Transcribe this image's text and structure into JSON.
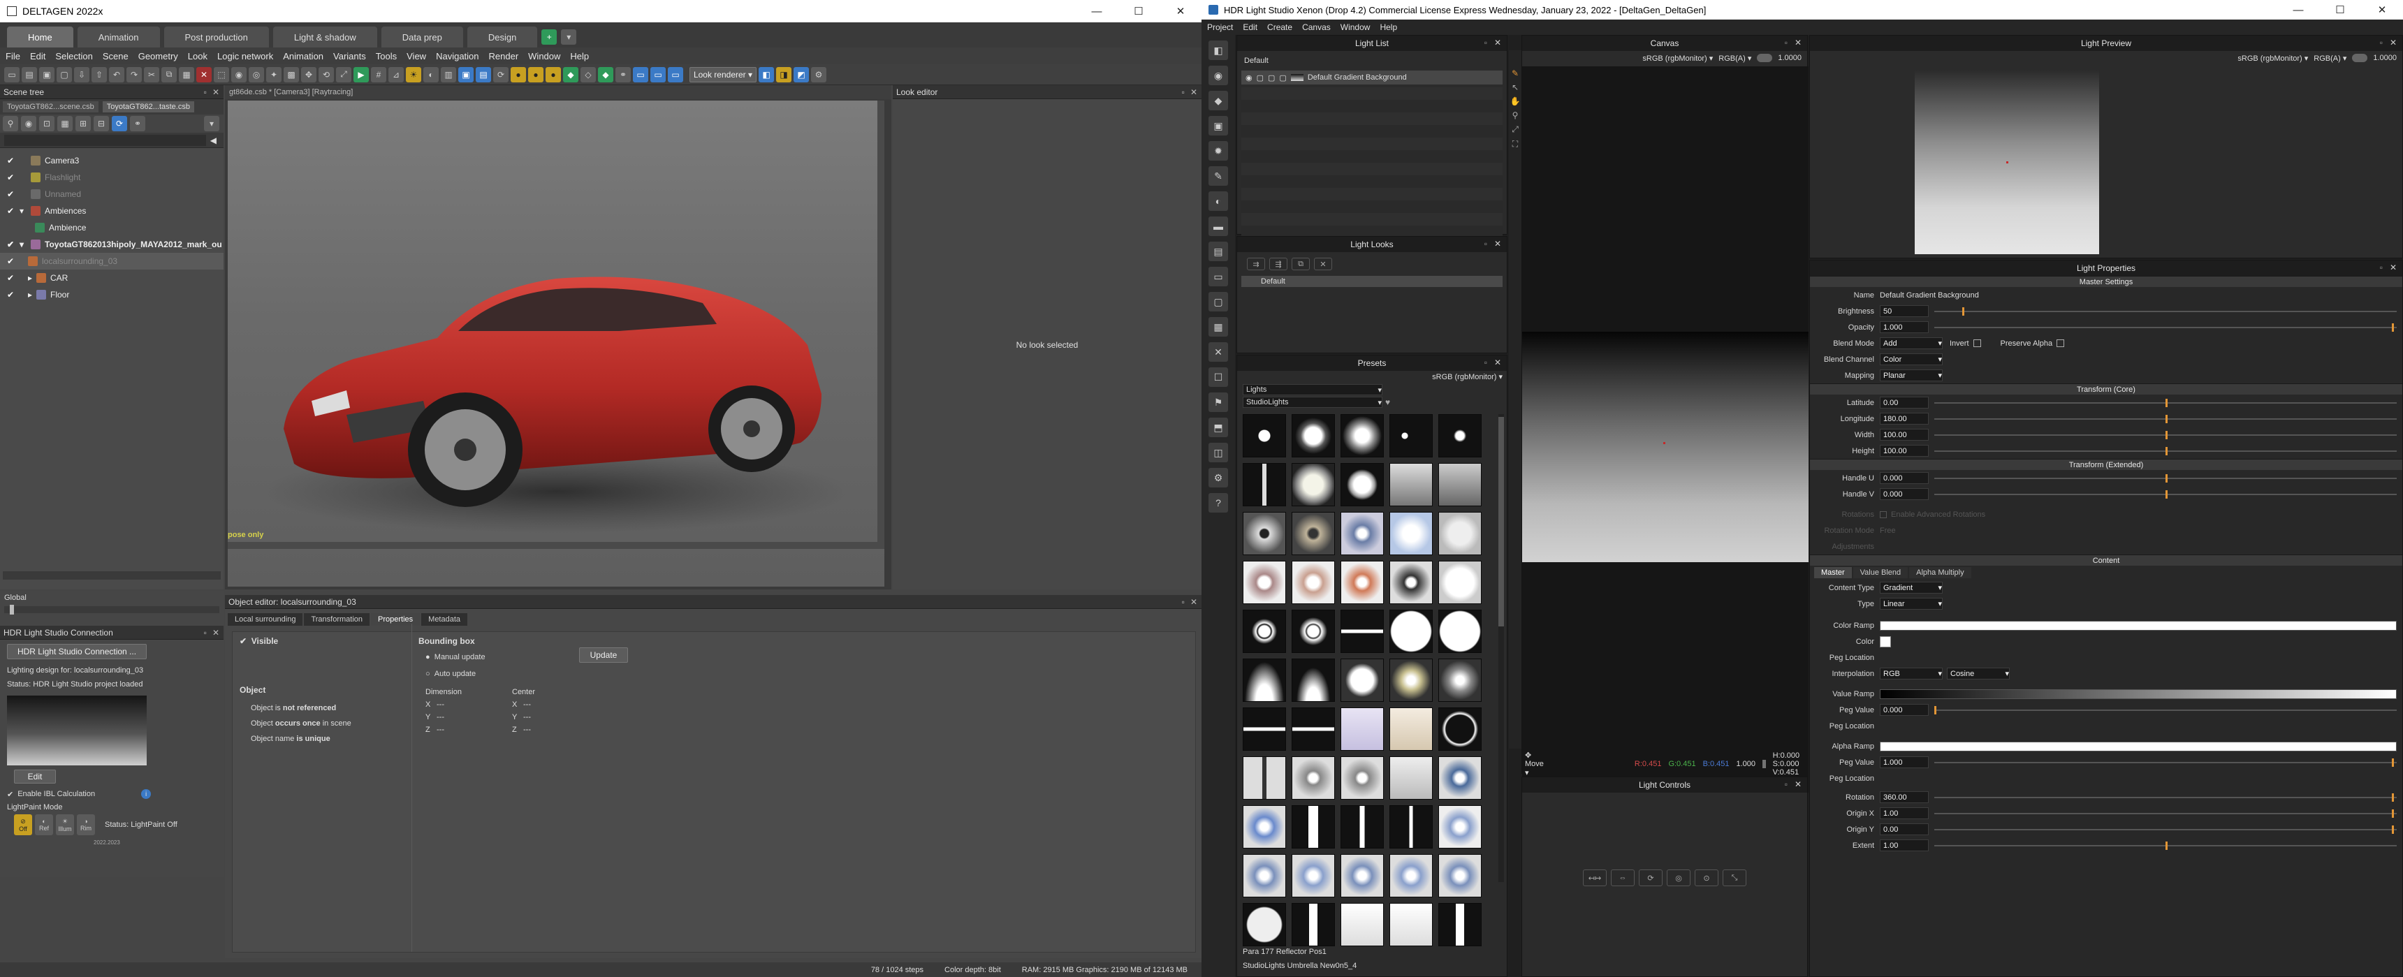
{
  "left_app": {
    "title": "DELTAGEN  2022x",
    "mode_tabs": [
      "Home",
      "Animation",
      "Post production",
      "Light & shadow",
      "Data prep",
      "Design"
    ],
    "menu": [
      "File",
      "Edit",
      "Selection",
      "Scene",
      "Geometry",
      "Look",
      "Logic network",
      "Animation",
      "Variants",
      "Tools",
      "View",
      "Navigation",
      "Render",
      "Window",
      "Help"
    ],
    "look_renderer": "Look renderer",
    "scene_tree": {
      "title": "Scene tree",
      "file_tabs": [
        "ToyotaGT862...scene.csb",
        "ToyotaGT862...taste.csb"
      ],
      "items": [
        {
          "label": "Camera3",
          "checked": true,
          "dim": false,
          "indent": 0
        },
        {
          "label": "Flashlight",
          "checked": true,
          "dim": true,
          "indent": 0
        },
        {
          "label": "Unnamed",
          "checked": true,
          "dim": true,
          "indent": 0
        },
        {
          "label": "Ambiences",
          "checked": true,
          "dim": false,
          "indent": 0
        },
        {
          "label": "Ambience",
          "checked": false,
          "dim": false,
          "indent": 1
        },
        {
          "label": "ToyotaGT862013hipoly_MAYA2012_mark_ou",
          "checked": true,
          "dim": false,
          "bold": true,
          "indent": 0
        },
        {
          "label": "localsurrounding_03",
          "checked": true,
          "dim": true,
          "indent": 1
        },
        {
          "label": "CAR",
          "checked": true,
          "dim": false,
          "indent": 1
        },
        {
          "label": "Floor",
          "checked": true,
          "dim": false,
          "indent": 1
        }
      ]
    },
    "viewport": {
      "tab_label": "gt86de.csb * [Camera3] [Raytracing]",
      "status_text": "pose only"
    },
    "look_editor": {
      "title": "Look editor",
      "empty_text": "No look selected"
    },
    "global_label": "Global",
    "hdr_connection": {
      "title": "HDR Light Studio Connection",
      "connect_button": "HDR Light Studio Connection ...",
      "lighting_design": "Lighting design for: localsurrounding_03",
      "status": "Status: HDR Light Studio project loaded",
      "edit_button": "Edit",
      "enable_ibl": "Enable IBL Calculation",
      "lightpaint_mode": "LightPaint Mode",
      "lightpaint_status": "Status: LightPaint Off",
      "lightpaint_buttons": [
        "Off",
        "Ref",
        "Illum",
        "Rim"
      ],
      "version": "2022.2023"
    },
    "object_editor": {
      "title": "Object editor: localsurrounding_03",
      "tabs": [
        "Local surrounding",
        "Transformation",
        "Properties",
        "Metadata"
      ],
      "active_tab": "Properties",
      "visible_label": "Visible",
      "object_header": "Object",
      "object_lines": [
        {
          "prefix": "Object is ",
          "bold": "not referenced",
          "suffix": ""
        },
        {
          "prefix": "Object ",
          "bold": "occurs once",
          "suffix": " in scene"
        },
        {
          "prefix": "Object name ",
          "bold": "is unique",
          "suffix": ""
        }
      ],
      "bbox_header": "Bounding box",
      "manual_update": "Manual update",
      "auto_update": "Auto update",
      "update_button": "Update",
      "dimension_label": "Dimension",
      "center_label": "Center",
      "axes": [
        "X",
        "Y",
        "Z"
      ],
      "dash": "---"
    },
    "statusbar": {
      "steps": "78 / 1024 steps",
      "color_depth": "Color depth: 8bit",
      "memory": "RAM: 2915 MB  Graphics: 2190 MB of 12143 MB"
    }
  },
  "right_app": {
    "title": "HDR Light Studio Xenon (Drop 4.2) Commercial License Express Wednesday, January 23, 2022 - [DeltaGen_DeltaGen]",
    "menu": [
      "Project",
      "Edit",
      "Create",
      "Canvas",
      "Window",
      "Help"
    ],
    "light_list": {
      "title": "Light List",
      "group": "Default",
      "item": "Default Gradient Background"
    },
    "light_looks": {
      "title": "Light Looks",
      "item": "Default"
    },
    "presets": {
      "title": "Presets",
      "colorspace": "sRGB (rgbMonitor)",
      "category": "Lights",
      "subcategory": "StudioLights",
      "footer_line1": "Para 177 Reflector Pos1",
      "footer_line2": "StudioLights Umbrella New0n5_4"
    },
    "canvas": {
      "title": "Canvas",
      "colorspace": "sRGB (rgbMonitor)",
      "channel": "RGB(A)",
      "exposure": "1.0000",
      "tool": "Move",
      "readout": {
        "r": "R:0.451",
        "g": "G:0.451",
        "b": "B:0.451",
        "a": "1.000",
        "hsv": "H:0.000 S:0.000 V:0.451"
      }
    },
    "light_controls": {
      "title": "Light Controls"
    },
    "light_preview": {
      "title": "Light Preview",
      "colorspace": "sRGB (rgbMonitor)",
      "channel": "RGB(A)",
      "exposure": "1.0000"
    },
    "light_properties": {
      "title": "Light Properties",
      "master_settings": "Master Settings",
      "name_label": "Name",
      "name_value": "Default Gradient Background",
      "brightness_label": "Brightness",
      "brightness_value": "50",
      "brightness_level": 0.06,
      "opacity_label": "Opacity",
      "opacity_value": "1.000",
      "opacity_level": 1.0,
      "blend_mode_label": "Blend Mode",
      "blend_mode_value": "Add",
      "invert_label": "Invert",
      "preserve_alpha_label": "Preserve Alpha",
      "blend_channel_label": "Blend Channel",
      "blend_channel_value": "Color",
      "mapping_label": "Mapping",
      "mapping_value": "Planar",
      "transform_core": "Transform (Core)",
      "latitude_label": "Latitude",
      "latitude_value": "0.00",
      "longitude_label": "Longitude",
      "longitude_value": "180.00",
      "width_label": "Width",
      "width_value": "100.00",
      "height_label": "Height",
      "height_value": "100.00",
      "transform_ext": "Transform (Extended)",
      "handle_u_label": "Handle U",
      "handle_u_value": "0.000",
      "handle_v_label": "Handle V",
      "handle_v_value": "0.000",
      "rotations_label": "Rotations",
      "advanced_rotations": "Enable Advanced Rotations",
      "rotation_mode_label": "Rotation Mode",
      "rotation_mode_value": "Free",
      "adjustments_label": "Adjustments",
      "content": "Content",
      "content_tabs": [
        "Master",
        "Value Blend",
        "Alpha Multiply"
      ],
      "content_type_label": "Content Type",
      "content_type_value": "Gradient",
      "type_label": "Type",
      "type_value": "Linear",
      "color_ramp_label": "Color Ramp",
      "color_label": "Color",
      "peg_location_label": "Peg Location",
      "interpolation_label": "Interpolation",
      "interpolation_value": "RGB",
      "interpolation_curve": "Cosine",
      "value_ramp_label": "Value Ramp",
      "peg_value_label": "Peg Value",
      "peg_value_1": "0.000",
      "peg_value_2": "1.000",
      "alpha_ramp_label": "Alpha Ramp",
      "rotation_label": "Rotation",
      "rotation_value": "360.00",
      "origin_x_label": "Origin X",
      "origin_x_value": "1.00",
      "origin_y_label": "Origin Y",
      "origin_y_value": "0.00",
      "extent_label": "Extent",
      "extent_value": "1.00"
    }
  },
  "colors": {
    "accent_orange": "#e39636",
    "selection_red": "#c62828",
    "deltagen_blue": "#3b7ac6"
  }
}
